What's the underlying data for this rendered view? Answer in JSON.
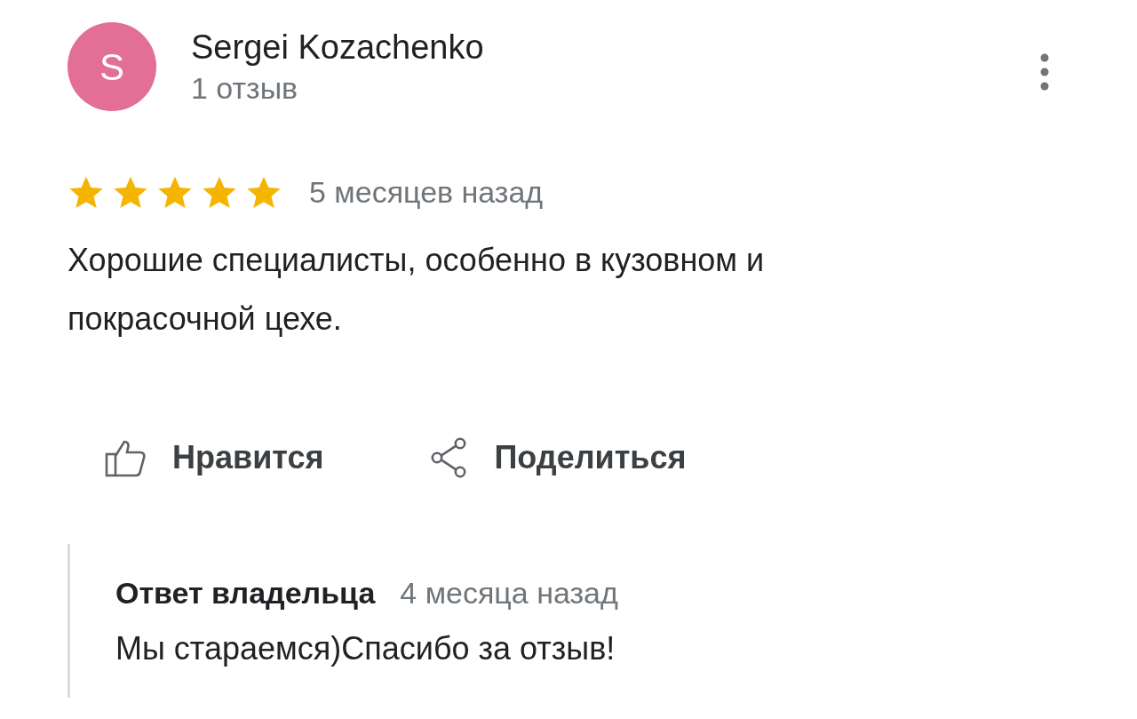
{
  "review": {
    "avatar_letter": "S",
    "author": "Sergei Kozachenko",
    "author_meta": "1 отзыв",
    "stars": 5,
    "time": "5 месяцев назад",
    "text": "Хорошие специалисты, особенно в кузовном и покрасочной цехе."
  },
  "actions": [
    {
      "kind": "like",
      "label": "Нравится"
    },
    {
      "kind": "share",
      "label": "Поделиться"
    }
  ],
  "owner_reply": {
    "title": "Ответ владельца",
    "time": "4 месяца назад",
    "text": "Мы стараемся)Спасибо за отзыв!"
  }
}
